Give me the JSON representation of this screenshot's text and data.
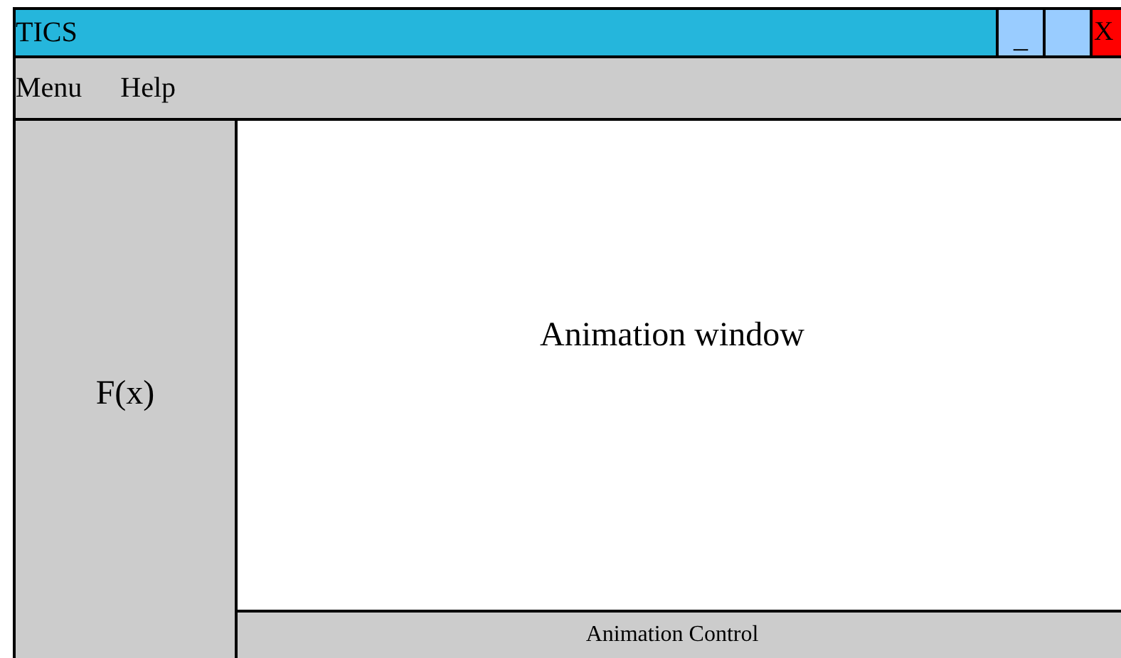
{
  "window": {
    "title": "TICS",
    "controls": [
      {
        "kind": "minimize",
        "label": "_"
      },
      {
        "kind": "maximize"
      },
      {
        "kind": "close",
        "label": "X"
      }
    ]
  },
  "menu": [
    "Menu",
    "Help"
  ],
  "sidebar": {
    "label": "F(x)"
  },
  "animation": {
    "label": "Animation window"
  },
  "control_bar": {
    "label": "Animation Control"
  }
}
